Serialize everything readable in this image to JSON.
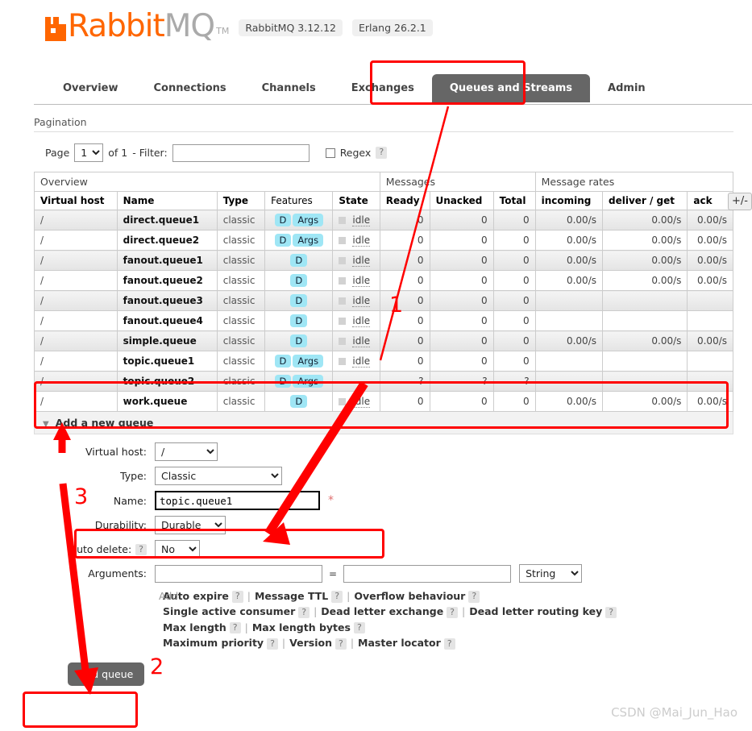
{
  "brand": {
    "name_orange": "Rabbit",
    "name_gray": "MQ",
    "tm": "TM",
    "version_badge": "RabbitMQ 3.12.12",
    "erlang_badge": "Erlang 26.2.1",
    "accent_color": "#FF6600"
  },
  "nav": {
    "tabs": [
      {
        "label": "Overview",
        "active": false
      },
      {
        "label": "Connections",
        "active": false
      },
      {
        "label": "Channels",
        "active": false
      },
      {
        "label": "Exchanges",
        "active": false
      },
      {
        "label": "Queues and Streams",
        "active": true
      },
      {
        "label": "Admin",
        "active": false
      }
    ]
  },
  "pagination": {
    "section_label": "Pagination",
    "page_label": "Page",
    "page_value": "1",
    "of_label": "of 1",
    "filter_label": "- Filter:",
    "filter_value": "",
    "filter_placeholder": "",
    "regex_label": "Regex",
    "help": "?"
  },
  "table": {
    "group_headers": {
      "overview": "Overview",
      "messages": "Messages",
      "message_rates": "Message rates"
    },
    "columns": [
      "Virtual host",
      "Name",
      "Type",
      "Features",
      "State",
      "Ready",
      "Unacked",
      "Total",
      "incoming",
      "deliver / get",
      "ack"
    ],
    "toggle_columns_label": "+/-",
    "rows": [
      {
        "vhost": "/",
        "name": "direct.queue1",
        "type": "classic",
        "features": [
          "D",
          "Args"
        ],
        "state": "idle",
        "ready": "0",
        "unacked": "0",
        "total": "0",
        "incoming": "0.00/s",
        "deliver_get": "0.00/s",
        "ack": "0.00/s"
      },
      {
        "vhost": "/",
        "name": "direct.queue2",
        "type": "classic",
        "features": [
          "D",
          "Args"
        ],
        "state": "idle",
        "ready": "0",
        "unacked": "0",
        "total": "0",
        "incoming": "0.00/s",
        "deliver_get": "0.00/s",
        "ack": "0.00/s"
      },
      {
        "vhost": "/",
        "name": "fanout.queue1",
        "type": "classic",
        "features": [
          "D"
        ],
        "state": "idle",
        "ready": "0",
        "unacked": "0",
        "total": "0",
        "incoming": "0.00/s",
        "deliver_get": "0.00/s",
        "ack": "0.00/s"
      },
      {
        "vhost": "/",
        "name": "fanout.queue2",
        "type": "classic",
        "features": [
          "D"
        ],
        "state": "idle",
        "ready": "0",
        "unacked": "0",
        "total": "0",
        "incoming": "0.00/s",
        "deliver_get": "0.00/s",
        "ack": "0.00/s"
      },
      {
        "vhost": "/",
        "name": "fanout.queue3",
        "type": "classic",
        "features": [
          "D"
        ],
        "state": "idle",
        "ready": "0",
        "unacked": "0",
        "total": "0",
        "incoming": "",
        "deliver_get": "",
        "ack": ""
      },
      {
        "vhost": "/",
        "name": "fanout.queue4",
        "type": "classic",
        "features": [
          "D"
        ],
        "state": "idle",
        "ready": "0",
        "unacked": "0",
        "total": "0",
        "incoming": "",
        "deliver_get": "",
        "ack": ""
      },
      {
        "vhost": "/",
        "name": "simple.queue",
        "type": "classic",
        "features": [
          "D"
        ],
        "state": "idle",
        "ready": "0",
        "unacked": "0",
        "total": "0",
        "incoming": "0.00/s",
        "deliver_get": "0.00/s",
        "ack": "0.00/s"
      },
      {
        "vhost": "/",
        "name": "topic.queue1",
        "type": "classic",
        "features": [
          "D",
          "Args"
        ],
        "state": "idle",
        "ready": "0",
        "unacked": "0",
        "total": "0",
        "incoming": "",
        "deliver_get": "",
        "ack": ""
      },
      {
        "vhost": "/",
        "name": "topic.queue2",
        "type": "classic",
        "features": [
          "D",
          "Args"
        ],
        "state": "",
        "ready": "?",
        "unacked": "?",
        "total": "?",
        "incoming": "",
        "deliver_get": "",
        "ack": ""
      },
      {
        "vhost": "/",
        "name": "work.queue",
        "type": "classic",
        "features": [
          "D"
        ],
        "state": "idle",
        "ready": "0",
        "unacked": "0",
        "total": "0",
        "incoming": "0.00/s",
        "deliver_get": "0.00/s",
        "ack": "0.00/s"
      }
    ]
  },
  "add_queue": {
    "title": "Add a new queue",
    "fields": {
      "vhost_label": "Virtual host:",
      "vhost_value": "/",
      "type_label": "Type:",
      "type_value": "Classic",
      "name_label": "Name:",
      "name_value": "topic.queue1",
      "name_required": "*",
      "durability_label": "Durability:",
      "durability_value": "Durable",
      "autodelete_label": "Auto delete:",
      "autodelete_value": "No",
      "arguments_label": "Arguments:",
      "arg_key_value": "",
      "arg_val_value": "",
      "arg_type_value": "String",
      "equals": "=",
      "help": "?"
    },
    "add_arg_label": "Add",
    "presets": [
      [
        "Auto expire",
        "Message TTL",
        "Overflow behaviour"
      ],
      [
        "Single active consumer",
        "Dead letter exchange",
        "Dead letter routing key"
      ],
      [
        "Max length",
        "Max length bytes"
      ],
      [
        "Maximum priority",
        "Version",
        "Master locator"
      ]
    ],
    "submit_label": "Add queue"
  },
  "annotations": {
    "markers": [
      "1",
      "2",
      "3"
    ]
  },
  "watermark": "CSDN @Mai_Jun_Hao"
}
